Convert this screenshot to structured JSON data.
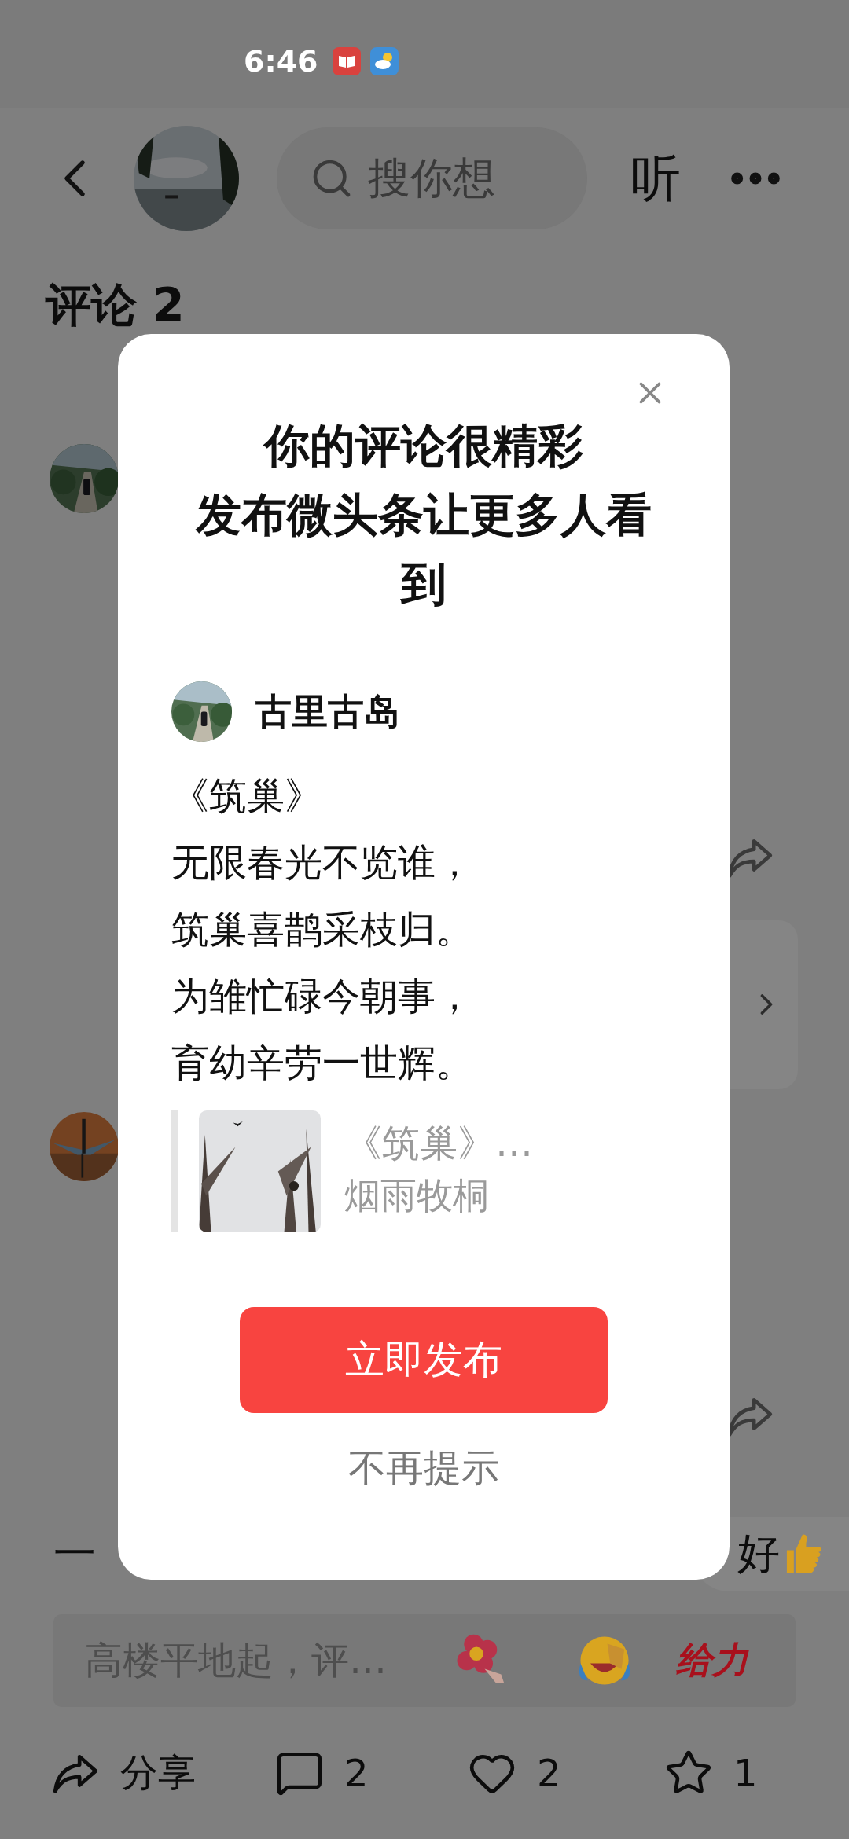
{
  "status_bar": {
    "time": "6:46"
  },
  "header": {
    "search": {
      "placeholder": "搜你想"
    },
    "listen": "听"
  },
  "comments_title": "评论 2",
  "partial_comment": {
    "start": "一",
    "end": "好"
  },
  "dialog": {
    "title_lines": [
      "你的评论很精彩",
      "发布微头条让更多人看到"
    ],
    "author": "古里古岛",
    "poem_lines": [
      "《筑巢》",
      "无限春光不览谁，",
      "筑巢喜鹊采枝归。",
      "为雏忙碌今朝事，",
      "育幼辛劳一世辉。"
    ],
    "quote": {
      "title": "《筑巢》…",
      "author": "烟雨牧桐"
    },
    "primary_button": "立即发布",
    "secondary_button": "不再提示"
  },
  "comment_input": {
    "placeholder": "高楼平地起，评…",
    "sticker_text": "给力"
  },
  "actions": [
    {
      "kind": "share",
      "label": "分享"
    },
    {
      "kind": "comment",
      "label": "2"
    },
    {
      "kind": "like",
      "label": "2"
    },
    {
      "kind": "favorite",
      "label": "1"
    }
  ]
}
